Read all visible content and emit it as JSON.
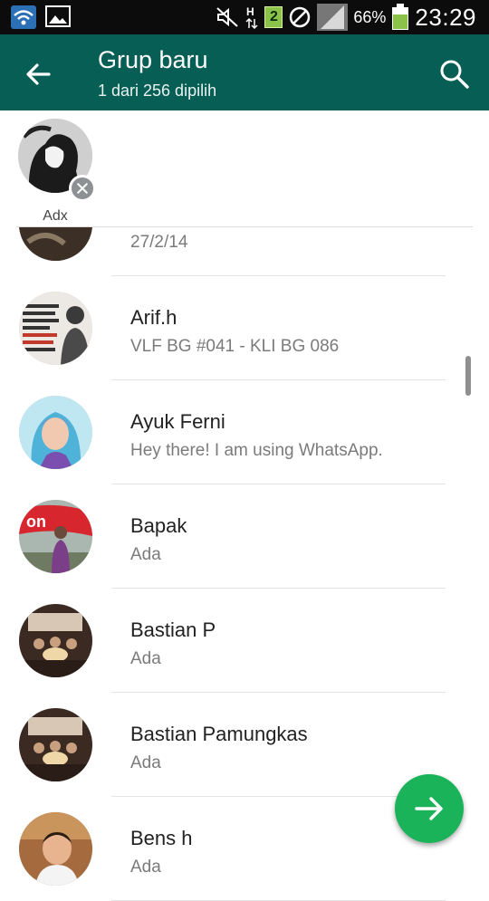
{
  "status_bar": {
    "battery_percent": "66%",
    "time": "23:29",
    "sim_slot": "2",
    "icons": [
      "wifi-icon",
      "gallery-icon",
      "mute-icon",
      "network-h-icon",
      "sim-2-icon",
      "blocked-icon",
      "signal-icon",
      "battery-icon"
    ]
  },
  "app_bar": {
    "title": "Grup baru",
    "subtitle": "1 dari 256 dipilih",
    "back_icon": "arrow-back-icon",
    "search_icon": "search-icon",
    "color": "#075e54"
  },
  "selected": [
    {
      "name": "Adx"
    }
  ],
  "contacts": [
    {
      "name": "",
      "status": "27/2/14",
      "avatar": "tree-photo"
    },
    {
      "name": "Arif.h",
      "status": "VLF BG #041 - KLI BG 086",
      "avatar": "poster-photo"
    },
    {
      "name": "Ayuk Ferni",
      "status": "Hey there! I am using WhatsApp.",
      "avatar": "selfie-photo"
    },
    {
      "name": "Bapak",
      "status": "Ada",
      "avatar": "airplane-photo"
    },
    {
      "name": "Bastian P",
      "status": "Ada",
      "avatar": "group-photo"
    },
    {
      "name": "Bastian Pamungkas",
      "status": "Ada",
      "avatar": "group-photo"
    },
    {
      "name": "Bens h",
      "status": "Ada",
      "avatar": "man-photo"
    }
  ],
  "fab": {
    "icon": "arrow-forward-icon",
    "color": "#1bb35a"
  }
}
